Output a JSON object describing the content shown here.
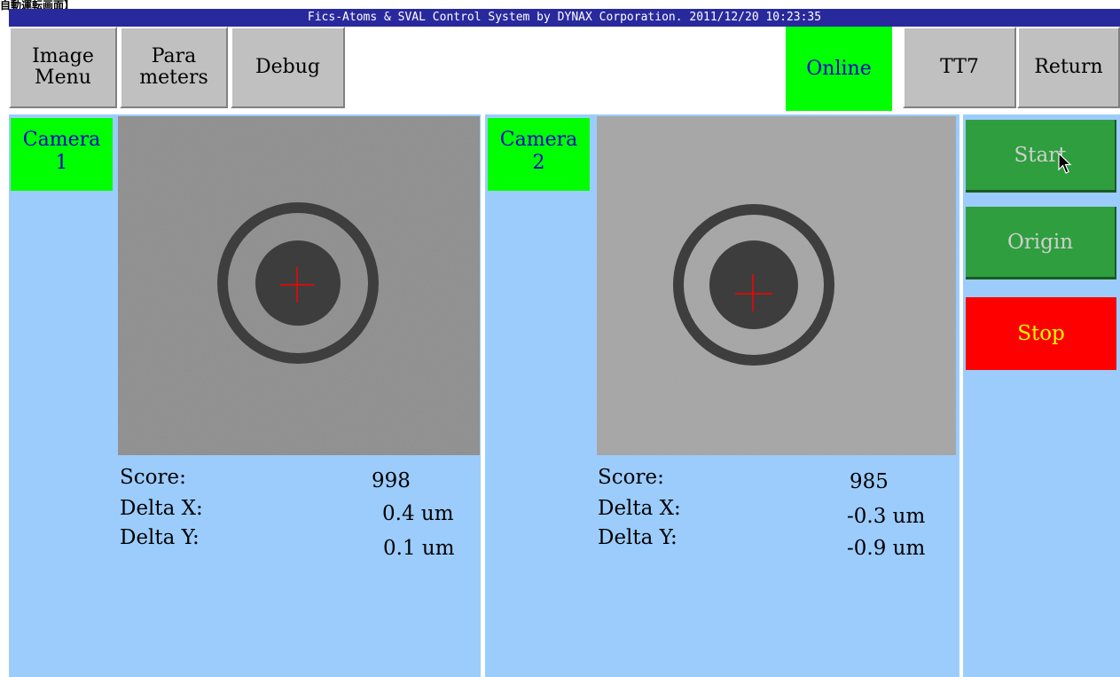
{
  "top_caption": "自動運転画面】",
  "titlebar": {
    "text": "Fics-Atoms & SVAL Control System by DYNAX Corporation. 2011/12/20 10:23:35"
  },
  "toolbar": {
    "image_menu": "Image\nMenu",
    "parameters": "Para\nmeters",
    "debug": "Debug",
    "online": "Online",
    "tt7": "TT7",
    "return": "Return"
  },
  "camera1": {
    "label": "Camera\n1",
    "score_label": "Score:",
    "score_value": "998",
    "dx_label": "Delta X:",
    "dx_value": "0.4 um",
    "dy_label": "Delta Y:",
    "dy_value": "0.1 um"
  },
  "camera2": {
    "label": "Camera\n2",
    "score_label": "Score:",
    "score_value": "985",
    "dx_label": "Delta X:",
    "dx_value": "-0.3 um",
    "dy_label": "Delta Y:",
    "dy_value": "-0.9 um"
  },
  "controls": {
    "start": "Start",
    "origin": "Origin",
    "stop": "Stop"
  },
  "colors": {
    "titlebar_bg": "#29299e",
    "panel_bg": "#9cccfc",
    "online_bg": "#00ff00",
    "start_bg": "#2e9e3e",
    "stop_bg": "#ff0000",
    "crosshair": "#ff0000"
  }
}
